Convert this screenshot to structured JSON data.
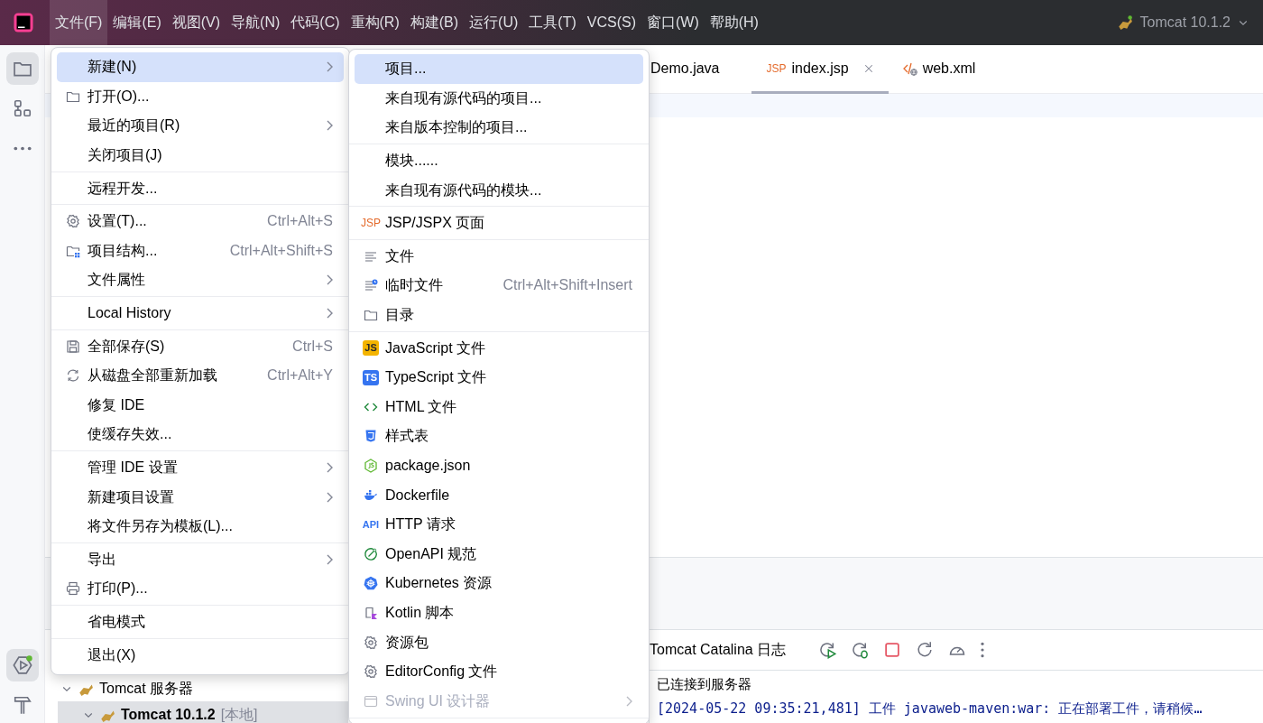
{
  "title_bar": {
    "menus": [
      {
        "label": "文件(F)",
        "selected": true
      },
      {
        "label": "编辑(E)",
        "selected": false
      },
      {
        "label": "视图(V)",
        "selected": false
      },
      {
        "label": "导航(N)",
        "selected": false
      },
      {
        "label": "代码(C)",
        "selected": false
      },
      {
        "label": "重构(R)",
        "selected": false
      },
      {
        "label": "构建(B)",
        "selected": false
      },
      {
        "label": "运行(U)",
        "selected": false
      },
      {
        "label": "工具(T)",
        "selected": false
      },
      {
        "label": "VCS(S)",
        "selected": false
      },
      {
        "label": "窗口(W)",
        "selected": false
      },
      {
        "label": "帮助(H)",
        "selected": false
      }
    ],
    "run_config": "Tomcat 10.1.2"
  },
  "tool_strip": {
    "top": [
      {
        "kind": "project",
        "selected": true
      },
      {
        "kind": "structure",
        "selected": false
      },
      {
        "kind": "more",
        "selected": false
      }
    ],
    "bottom": [
      {
        "kind": "run",
        "selected": true
      },
      {
        "kind": "build",
        "selected": false
      }
    ]
  },
  "editor_tabs": [
    {
      "label": "Demo.java",
      "selected": false,
      "kind": "plain"
    },
    {
      "label": "index.jsp",
      "selected": true,
      "kind": "jsp",
      "icon_text": "JSP"
    },
    {
      "label": "web.xml",
      "selected": false,
      "kind": "xml"
    }
  ],
  "file_menu": [
    {
      "kind": "plain",
      "label": "新建(N)",
      "submenu": true,
      "selected": true
    },
    {
      "kind": "folder",
      "label": "打开(O)...",
      "selected": false
    },
    {
      "kind": "plain",
      "label": "最近的项目(R)",
      "submenu": true,
      "selected": false
    },
    {
      "kind": "plain",
      "label": "关闭项目(J)",
      "selected": false
    },
    {
      "kind": "separator"
    },
    {
      "kind": "plain",
      "label": "远程开发...",
      "selected": false
    },
    {
      "kind": "separator"
    },
    {
      "kind": "gear",
      "label": "设置(T)...",
      "shortcut": "Ctrl+Alt+S",
      "selected": false
    },
    {
      "kind": "structure",
      "label": "项目结构...",
      "shortcut": "Ctrl+Alt+Shift+S",
      "selected": false
    },
    {
      "kind": "plain",
      "label": "文件属性",
      "submenu": true,
      "selected": false
    },
    {
      "kind": "separator"
    },
    {
      "kind": "plain",
      "label": "Local History",
      "submenu": true,
      "selected": false
    },
    {
      "kind": "separator"
    },
    {
      "kind": "save",
      "label": "全部保存(S)",
      "shortcut": "Ctrl+S",
      "selected": false
    },
    {
      "kind": "reload",
      "label": "从磁盘全部重新加载",
      "shortcut": "Ctrl+Alt+Y",
      "selected": false
    },
    {
      "kind": "plain",
      "label": "修复 IDE",
      "selected": false
    },
    {
      "kind": "plain",
      "label": "使缓存失效...",
      "selected": false
    },
    {
      "kind": "separator"
    },
    {
      "kind": "plain",
      "label": "管理 IDE 设置",
      "submenu": true,
      "selected": false
    },
    {
      "kind": "plain",
      "label": "新建项目设置",
      "submenu": true,
      "selected": false
    },
    {
      "kind": "plain",
      "label": "将文件另存为模板(L)...",
      "selected": false
    },
    {
      "kind": "separator"
    },
    {
      "kind": "plain",
      "label": "导出",
      "submenu": true,
      "selected": false
    },
    {
      "kind": "printer",
      "label": "打印(P)...",
      "selected": false
    },
    {
      "kind": "separator"
    },
    {
      "kind": "plain",
      "label": "省电模式",
      "selected": false
    },
    {
      "kind": "separator"
    },
    {
      "kind": "plain",
      "label": "退出(X)",
      "selected": false
    }
  ],
  "new_submenu": [
    {
      "kind": "plain",
      "label": "项目...",
      "selected": true
    },
    {
      "kind": "plain",
      "label": "来自现有源代码的项目...",
      "selected": false
    },
    {
      "kind": "plain",
      "label": "来自版本控制的项目...",
      "selected": false
    },
    {
      "kind": "separator"
    },
    {
      "kind": "plain",
      "label": "模块......",
      "selected": false
    },
    {
      "kind": "plain",
      "label": "来自现有源代码的模块...",
      "selected": false
    },
    {
      "kind": "separator"
    },
    {
      "kind": "jsp",
      "icon_text": "JSP",
      "label": "JSP/JSPX 页面",
      "selected": false
    },
    {
      "kind": "separator"
    },
    {
      "kind": "text",
      "label": "文件",
      "selected": false
    },
    {
      "kind": "scratch",
      "label": "临时文件",
      "shortcut": "Ctrl+Alt+Shift+Insert",
      "selected": false
    },
    {
      "kind": "folder",
      "label": "目录",
      "selected": false
    },
    {
      "kind": "separator"
    },
    {
      "kind": "js",
      "icon_text": "JS",
      "label": "JavaScript 文件",
      "selected": false
    },
    {
      "kind": "ts",
      "icon_text": "TS",
      "label": "TypeScript 文件",
      "selected": false
    },
    {
      "kind": "html",
      "label": "HTML 文件",
      "selected": false
    },
    {
      "kind": "css",
      "label": "样式表",
      "selected": false
    },
    {
      "kind": "node",
      "label": "package.json",
      "selected": false
    },
    {
      "kind": "docker",
      "label": "Dockerfile",
      "selected": false
    },
    {
      "kind": "api",
      "icon_text": "API",
      "label": "HTTP 请求",
      "selected": false
    },
    {
      "kind": "openapi",
      "label": "OpenAPI 规范",
      "selected": false
    },
    {
      "kind": "kubernetes",
      "label": "Kubernetes 资源",
      "selected": false
    },
    {
      "kind": "kotlin",
      "label": "Kotlin 脚本",
      "selected": false
    },
    {
      "kind": "gear",
      "label": "资源包",
      "selected": false
    },
    {
      "kind": "gear",
      "label": "EditorConfig 文件",
      "selected": false
    },
    {
      "kind": "form",
      "label": "Swing UI 设计器",
      "submenu": true,
      "disabled": true,
      "selected": false
    },
    {
      "kind": "separator"
    }
  ],
  "services_tree": [
    {
      "label": "Tomcat 服务器",
      "expanded": true,
      "selected": false,
      "children": [
        {
          "label": "Tomcat 10.1.2",
          "suffix": "[本地]",
          "expanded": true,
          "selected": true
        }
      ]
    }
  ],
  "run_panel": {
    "title": "Tomcat Catalina 日志",
    "console": [
      {
        "kind": "plain",
        "text": "已连接到服务器"
      },
      {
        "kind": "info",
        "text": "[2024-05-22 09:35:21,481] 工件 javaweb-maven:war: 正在部署工件，请稍候…"
      }
    ]
  }
}
